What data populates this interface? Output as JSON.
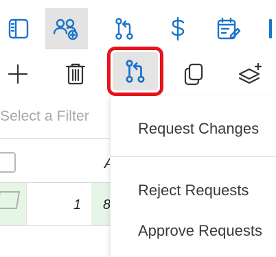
{
  "toolbar_top": {
    "icons": [
      "sidebar-panel-icon",
      "add-users-icon",
      "pull-request-icon",
      "dollar-icon",
      "calendar-edit-icon"
    ]
  },
  "toolbar_second": {
    "icons": [
      "plus-icon",
      "trash-icon",
      "pull-request-icon",
      "copy-icon",
      "layers-add-icon"
    ],
    "highlight_color": "#e8131a"
  },
  "grid": {
    "filter_placeholder": "Select a Filter",
    "header_partial": "A",
    "row1": {
      "number": "1",
      "partial_value": "8"
    },
    "row_highlight_color": "#e6f6e6"
  },
  "menu": {
    "items": [
      "Request Changes",
      "Reject Requests",
      "Approve Requests"
    ]
  }
}
